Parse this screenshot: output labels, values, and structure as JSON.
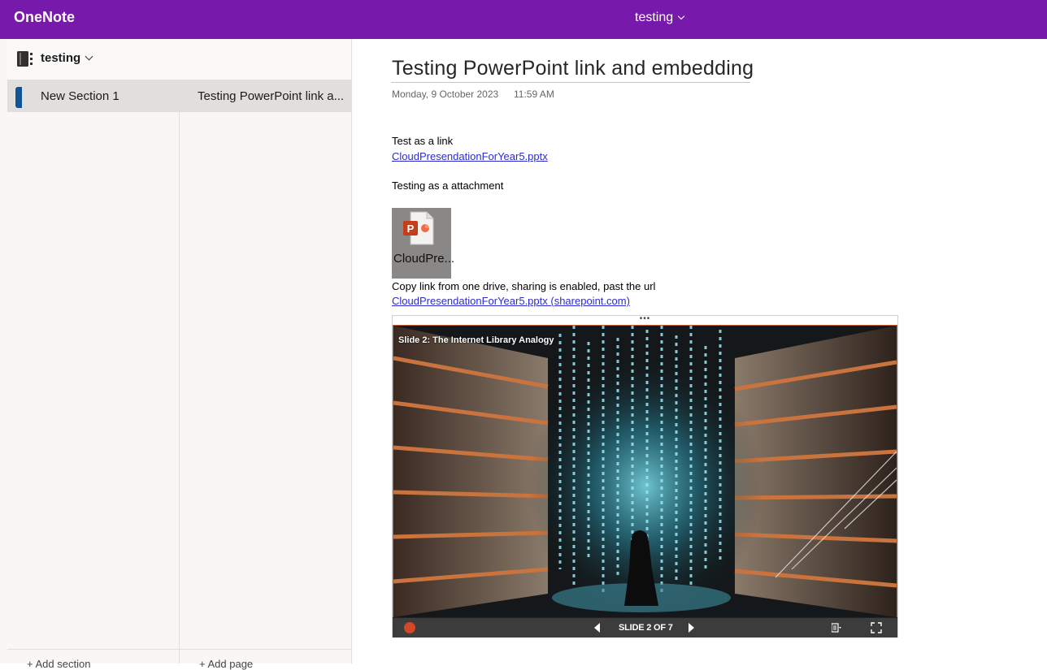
{
  "app": {
    "name": "OneNote"
  },
  "header": {
    "notebook_switch": "testing"
  },
  "sidebar": {
    "notebook_name": "testing",
    "sections": [
      {
        "label": "New Section 1",
        "color": "#0f5596"
      }
    ],
    "pages": [
      {
        "label": "Testing PowerPoint link a..."
      }
    ],
    "add_section_label": "+ Add section",
    "add_page_label": "+ Add page"
  },
  "page": {
    "title": "Testing PowerPoint link and embedding",
    "date": "Monday, 9 October 2023",
    "time": "11:59 AM",
    "blocks": {
      "link_heading": "Test as a link",
      "link1": "CloudPresendationForYear5.pptx",
      "attachment_heading": "Testing as a attachment",
      "attachment_name": "CloudPre...",
      "copy_note": "Copy link from one drive, sharing is enabled, past the url",
      "link2": "CloudPresendationForYear5.pptx (sharepoint.com)"
    },
    "embed": {
      "handle": "•••",
      "slide_caption": "Slide 2: The Internet Library Analogy",
      "counter": "SLIDE 2 OF 7"
    }
  },
  "colors": {
    "brand": "#7719aa",
    "link": "#2b2bd6",
    "powerpoint": "#d24726"
  }
}
